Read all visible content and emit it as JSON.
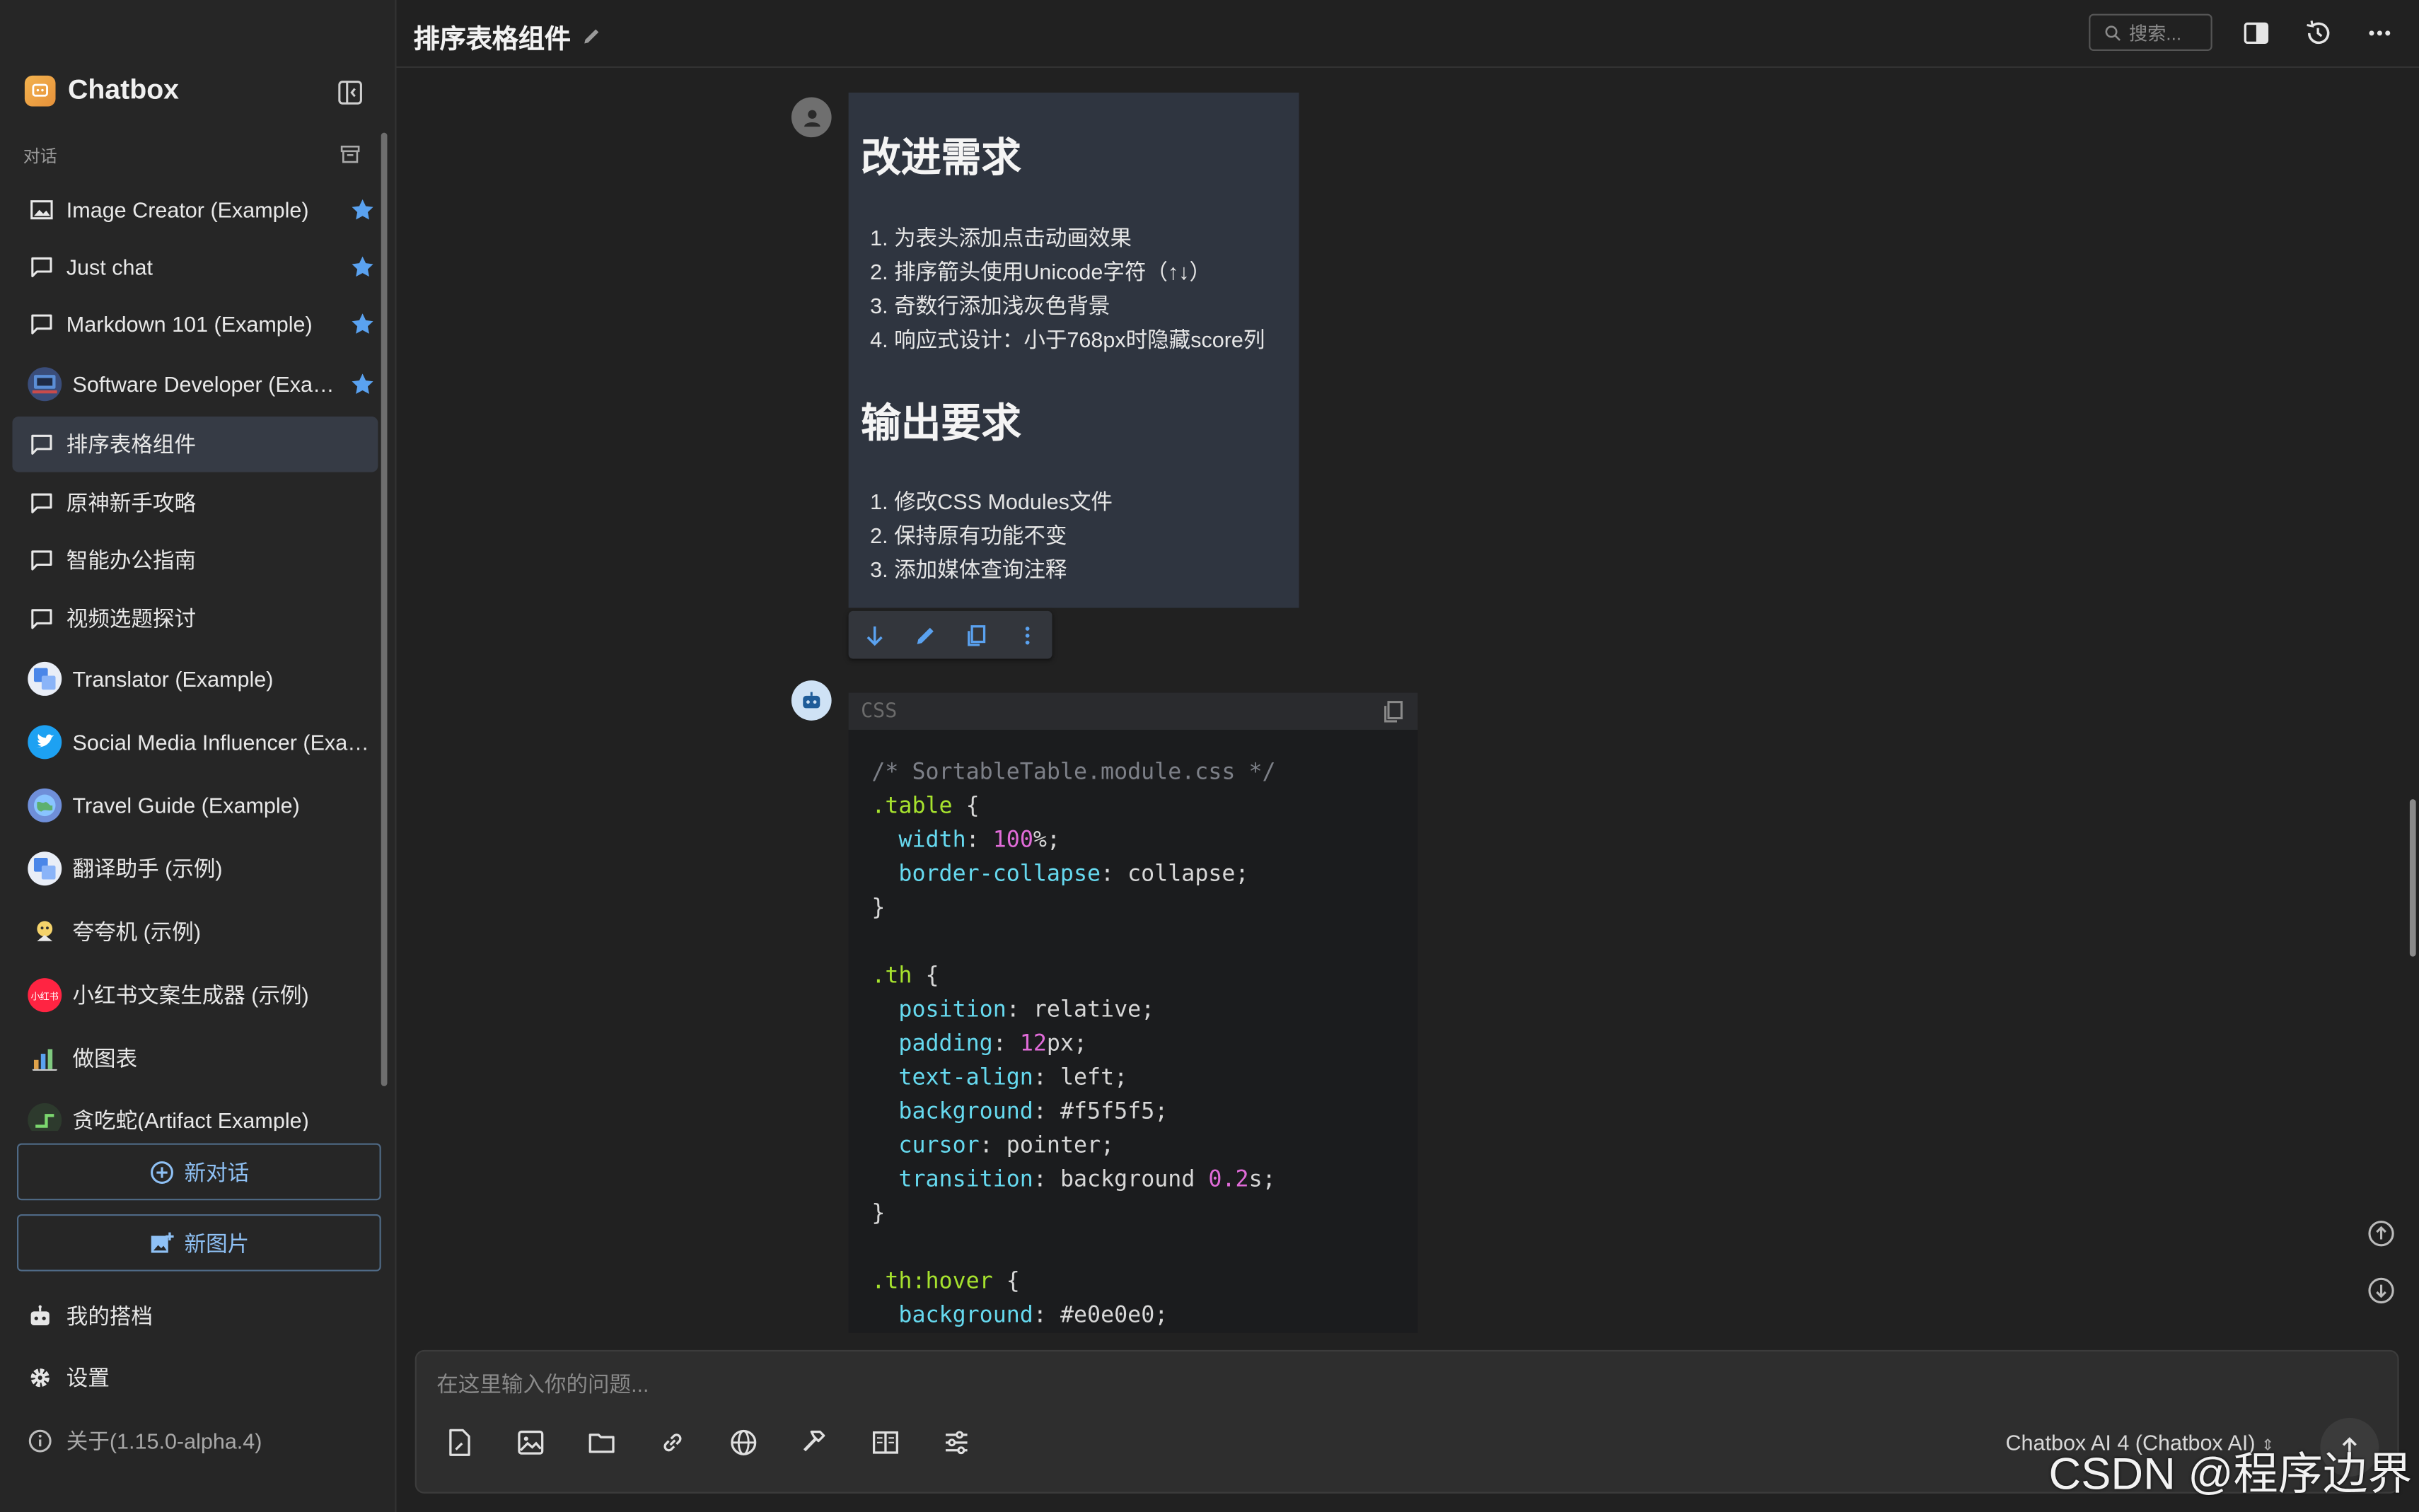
{
  "app": {
    "name": "Chatbox"
  },
  "sidebar": {
    "section_label": "对话",
    "conversations": [
      {
        "label": "Image Creator (Example)",
        "icon": "image-icon",
        "starred": true,
        "active": false
      },
      {
        "label": "Just chat",
        "icon": "chat-bubble-icon",
        "starred": true,
        "active": false
      },
      {
        "label": "Markdown 101 (Example)",
        "icon": "chat-bubble-icon",
        "starred": true,
        "active": false
      },
      {
        "label": "Software Developer (Example)",
        "icon": "developer-avatar",
        "starred": true,
        "active": false
      },
      {
        "label": "排序表格组件",
        "icon": "chat-bubble-icon",
        "starred": false,
        "active": true
      },
      {
        "label": "原神新手攻略",
        "icon": "chat-bubble-icon",
        "starred": false,
        "active": false
      },
      {
        "label": "智能办公指南",
        "icon": "chat-bubble-icon",
        "starred": false,
        "active": false
      },
      {
        "label": "视频选题探讨",
        "icon": "chat-bubble-icon",
        "starred": false,
        "active": false
      },
      {
        "label": "Translator (Example)",
        "icon": "translator-avatar",
        "starred": false,
        "active": false
      },
      {
        "label": "Social Media Influencer (Example)",
        "icon": "twitter-avatar",
        "starred": false,
        "active": false
      },
      {
        "label": "Travel Guide (Example)",
        "icon": "globe-avatar",
        "starred": false,
        "active": false
      },
      {
        "label": "翻译助手 (示例)",
        "icon": "translator-avatar",
        "starred": false,
        "active": false
      },
      {
        "label": "夸夸机 (示例)",
        "icon": "cheer-avatar",
        "starred": false,
        "active": false
      },
      {
        "label": "小红书文案生成器 (示例)",
        "icon": "xiaohongshu-avatar",
        "starred": false,
        "active": false,
        "avatar_text": "小红书"
      },
      {
        "label": "做图表",
        "icon": "chart-avatar",
        "starred": false,
        "active": false
      },
      {
        "label": "贪吃蛇(Artifact Example)",
        "icon": "snake-avatar",
        "starred": false,
        "active": false
      }
    ],
    "new_chat_label": "新对话",
    "new_image_label": "新图片",
    "my_copilots_label": "我的搭档",
    "settings_label": "设置",
    "about_label": "关于(1.15.0-alpha.4)"
  },
  "topbar": {
    "title": "排序表格组件",
    "search_placeholder": "搜索..."
  },
  "user_message": {
    "heading1": "改进需求",
    "list1": [
      "1. 为表头添加点击动画效果",
      "2. 排序箭头使用Unicode字符（↑↓）",
      "3. 奇数行添加浅灰色背景",
      "4. 响应式设计：小于768px时隐藏score列"
    ],
    "heading2": "输出要求",
    "list2": [
      "1. 修改CSS Modules文件",
      "2. 保持原有功能不变",
      "3. 添加媒体查询注释"
    ]
  },
  "code_block": {
    "language": "CSS",
    "lines": [
      [
        {
          "t": "/* SortableTable.module.css */",
          "c": "com"
        }
      ],
      [
        {
          "t": ".table",
          "c": "sel"
        },
        {
          "t": " {",
          "c": ""
        }
      ],
      [
        {
          "t": "  ",
          "c": ""
        },
        {
          "t": "width",
          "c": "prop"
        },
        {
          "t": ": ",
          "c": ""
        },
        {
          "t": "100",
          "c": "num"
        },
        {
          "t": "%;",
          "c": ""
        }
      ],
      [
        {
          "t": "  ",
          "c": ""
        },
        {
          "t": "border-collapse",
          "c": "prop"
        },
        {
          "t": ": collapse;",
          "c": ""
        }
      ],
      [
        {
          "t": "}",
          "c": ""
        }
      ],
      [
        {
          "t": "",
          "c": ""
        }
      ],
      [
        {
          "t": ".th",
          "c": "sel"
        },
        {
          "t": " {",
          "c": ""
        }
      ],
      [
        {
          "t": "  ",
          "c": ""
        },
        {
          "t": "position",
          "c": "prop"
        },
        {
          "t": ": relative;",
          "c": ""
        }
      ],
      [
        {
          "t": "  ",
          "c": ""
        },
        {
          "t": "padding",
          "c": "prop"
        },
        {
          "t": ": ",
          "c": ""
        },
        {
          "t": "12",
          "c": "num"
        },
        {
          "t": "px;",
          "c": ""
        }
      ],
      [
        {
          "t": "  ",
          "c": ""
        },
        {
          "t": "text-align",
          "c": "prop"
        },
        {
          "t": ": left;",
          "c": ""
        }
      ],
      [
        {
          "t": "  ",
          "c": ""
        },
        {
          "t": "background",
          "c": "prop"
        },
        {
          "t": ": #f5f5f5;",
          "c": ""
        }
      ],
      [
        {
          "t": "  ",
          "c": ""
        },
        {
          "t": "cursor",
          "c": "prop"
        },
        {
          "t": ": pointer;",
          "c": ""
        }
      ],
      [
        {
          "t": "  ",
          "c": ""
        },
        {
          "t": "transition",
          "c": "prop"
        },
        {
          "t": ": background ",
          "c": ""
        },
        {
          "t": "0.2",
          "c": "num"
        },
        {
          "t": "s;",
          "c": ""
        }
      ],
      [
        {
          "t": "}",
          "c": ""
        }
      ],
      [
        {
          "t": "",
          "c": ""
        }
      ],
      [
        {
          "t": ".th:hover",
          "c": "sel"
        },
        {
          "t": " {",
          "c": ""
        }
      ],
      [
        {
          "t": "  ",
          "c": ""
        },
        {
          "t": "background",
          "c": "prop"
        },
        {
          "t": ": #e0e0e0;",
          "c": ""
        }
      ]
    ]
  },
  "composer": {
    "placeholder": "在这里输入你的问题...",
    "model_label": "Chatbox AI 4 (Chatbox AI)"
  },
  "watermark": "CSDN @程序边界",
  "colors": {
    "accent": "#8fc1f5",
    "star": "#5aa2f0",
    "active_item": "#363b45",
    "user_bubble": "#2f3540"
  }
}
